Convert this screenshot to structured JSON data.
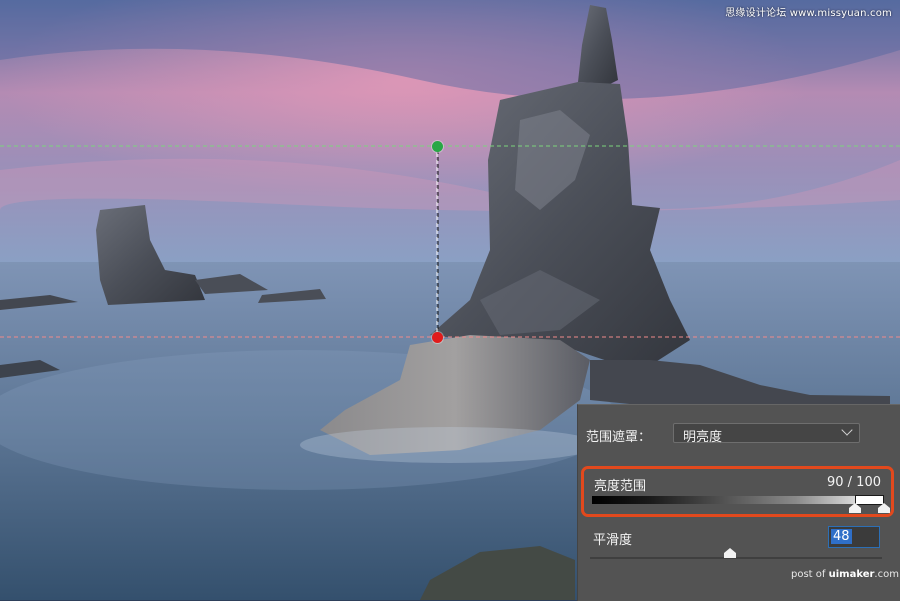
{
  "watermark": "思缘设计论坛  www.missyuan.com",
  "credit": {
    "prefix": "post of",
    "brand": "uimaker",
    "suffix": ".com"
  },
  "colors": {
    "highlight_guide": "#7cd47c",
    "shadow_guide": "#f08a8a",
    "highlight_dot": "#28a745",
    "shadow_dot": "#e11b1b",
    "accent_outline": "#e2491d",
    "panel_bg": "#535353"
  },
  "panel": {
    "range_mask": {
      "label": "范围遮罩：",
      "selected": "明亮度"
    },
    "luminance_range": {
      "label": "亮度范围",
      "value_text": "90 / 100",
      "min": 90,
      "max": 100
    },
    "smoothness": {
      "label": "平滑度",
      "value": "48"
    }
  }
}
